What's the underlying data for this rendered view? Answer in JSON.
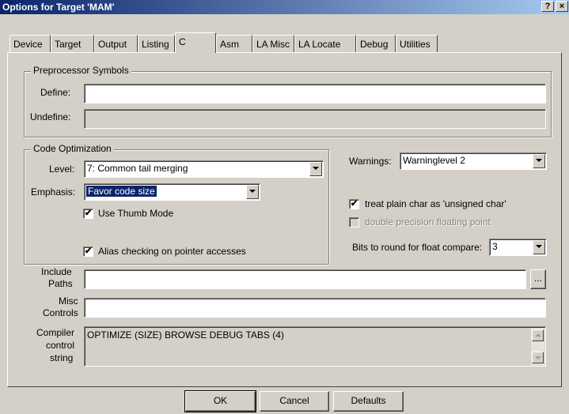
{
  "window": {
    "title": "Options for Target 'MAM'",
    "help_label": "?",
    "close_label": "×"
  },
  "tabs": [
    {
      "label": "Device"
    },
    {
      "label": "Target"
    },
    {
      "label": "Output"
    },
    {
      "label": "Listing"
    },
    {
      "label": "C"
    },
    {
      "label": "Asm"
    },
    {
      "label": "LA Misc"
    },
    {
      "label": "LA Locate"
    },
    {
      "label": "Debug"
    },
    {
      "label": "Utilities"
    }
  ],
  "active_tab": "C",
  "preprocessor": {
    "legend": "Preprocessor Symbols",
    "define_label": "Define:",
    "define_value": "",
    "undefine_label": "Undefine:",
    "undefine_value": ""
  },
  "optimization": {
    "legend": "Code Optimization",
    "level_label": "Level:",
    "level_value": "7: Common tail merging",
    "emphasis_label": "Emphasis:",
    "emphasis_value": "Favor code size",
    "thumb_label": "Use Thumb Mode",
    "thumb_checked": true,
    "alias_label": "Alias checking on pointer accesses",
    "alias_checked": true
  },
  "warnings": {
    "label": "Warnings:",
    "value": "Warninglevel 2"
  },
  "options": {
    "plain_char_label": "treat plain char as 'unsigned char'",
    "plain_char_checked": true,
    "double_label": "double precision floating point",
    "double_checked": false,
    "double_disabled": true,
    "bits_label": "Bits to round for float compare:",
    "bits_value": "3"
  },
  "include": {
    "label_line1": "Include",
    "label_line2": "Paths",
    "value": "",
    "browse_label": "..."
  },
  "misc": {
    "label_line1": "Misc",
    "label_line2": "Controls",
    "value": ""
  },
  "compiler": {
    "label_line1": "Compiler",
    "label_line2": "control",
    "label_line3": "string",
    "value": "OPTIMIZE (SIZE) BROWSE DEBUG TABS (4)"
  },
  "buttons": {
    "ok": "OK",
    "cancel": "Cancel",
    "defaults": "Defaults"
  },
  "colors": {
    "face": "#d4d0c8",
    "titlebar": "#0a246a",
    "selection": "#0a246a"
  }
}
